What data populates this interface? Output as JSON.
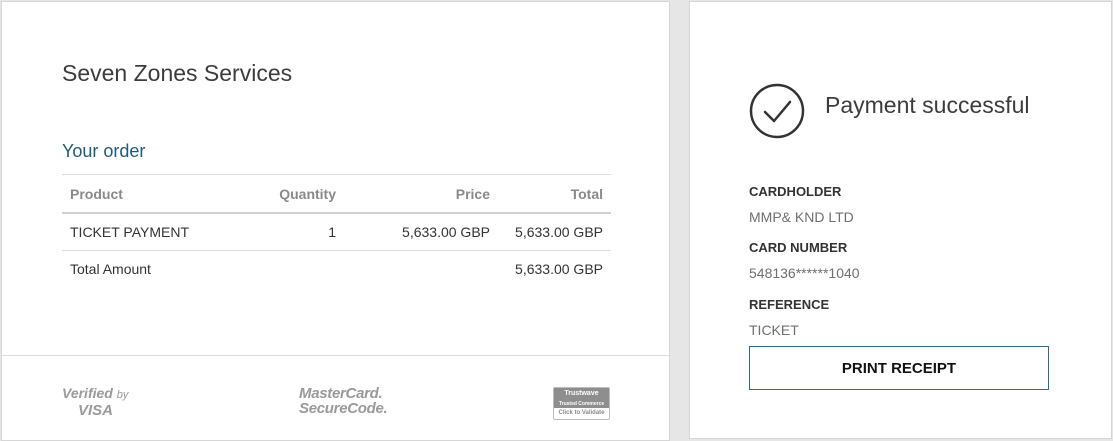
{
  "order": {
    "merchant_name": "Seven Zones Services",
    "heading": "Your order",
    "columns": [
      "Product",
      "Quantity",
      "Price",
      "Total"
    ],
    "rows": [
      {
        "product": "TICKET PAYMENT",
        "quantity": "1",
        "price": "5,633.00 GBP",
        "total": "5,633.00 GBP"
      }
    ],
    "total_label": "Total Amount",
    "total_value": "5,633.00 GBP"
  },
  "footer": {
    "visa_verified": "Verified",
    "visa_by": "by",
    "visa_brand": "VISA",
    "mastercard_line1": "MasterCard.",
    "mastercard_line2": "SecureCode.",
    "trustwave_line1": "Trustwave",
    "trustwave_line2": "Trusted Commerce",
    "trustwave_line3": "Click to Validate"
  },
  "payment": {
    "status": "Payment successful",
    "icon": "check-circle-icon",
    "cardholder_label": "CARDHOLDER",
    "cardholder_value": "MMP& KND LTD",
    "card_number_label": "CARD NUMBER",
    "card_number_value": "548136******1040",
    "reference_label": "REFERENCE",
    "reference_value": "TICKET",
    "print_button": "PRINT RECEIPT"
  },
  "colors": {
    "heading_accent": "#1f5b7a",
    "button_border": "#2e6a8c",
    "background": "#e6e6e6"
  }
}
